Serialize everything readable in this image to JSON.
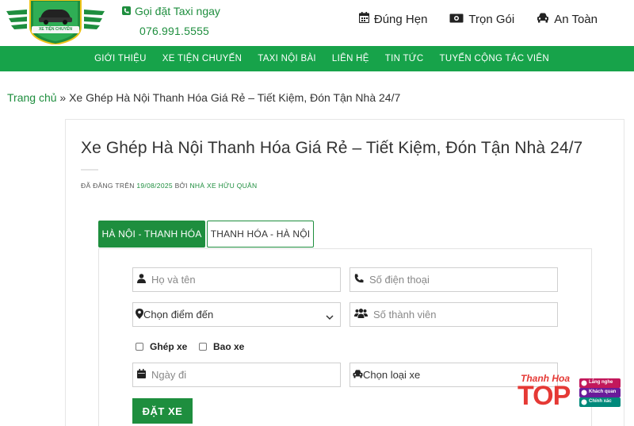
{
  "header": {
    "logo_text": "XE TIỆN CHUYẾN",
    "call_label": "Gọi đặt Taxi ngay",
    "phone": "076.991.5555",
    "features": [
      {
        "label": "Đúng Hẹn",
        "icon": "calendar-icon"
      },
      {
        "label": "Trọn Gói",
        "icon": "money-icon"
      },
      {
        "label": "An Toàn",
        "icon": "car-icon"
      }
    ]
  },
  "nav": {
    "items": [
      "GIỚI THIỆU",
      "XE TIỆN CHUYẾN",
      "TAXI NỘI BÀI",
      "LIÊN HỆ",
      "TIN TỨC",
      "TUYỂN CỘNG TÁC VIÊN"
    ]
  },
  "breadcrumb": {
    "home": "Trang chủ",
    "sep": "»",
    "current": "Xe Ghép Hà Nội Thanh Hóa Giá Rẻ – Tiết Kiệm, Đón Tận Nhà 24/7"
  },
  "article": {
    "title": "Xe Ghép Hà Nội Thanh Hóa Giá Rẻ – Tiết Kiệm, Đón Tận Nhà 24/7",
    "meta_prefix": "ĐÃ ĐĂNG TRÊN",
    "date": "19/08/2025",
    "meta_by": "BỞI",
    "author": "NHÀ XE HỮU QUÂN"
  },
  "tabs": [
    "HÀ NỘI - THANH HÓA",
    "THANH HÓA - HÀ NỘI"
  ],
  "form": {
    "name_placeholder": "Họ và tên",
    "phone_placeholder": "Số điện thoại",
    "destination_select": "Chọn điểm đến",
    "members_placeholder": "Số thành viên",
    "option_share": "Ghép xe",
    "option_private": "Bao xe",
    "date_placeholder": "Ngày đi",
    "car_type_select": "Chọn loại xe",
    "submit": "ĐẶT XE"
  },
  "watermark": {
    "brand_top": "Thanh Hoa",
    "brand_main": "TOP",
    "badges": [
      "Lắng nghe",
      "Khách quan",
      "Chính xác"
    ]
  },
  "colors": {
    "brand_green": "#17a34a",
    "text_green": "#1e8e3e"
  }
}
